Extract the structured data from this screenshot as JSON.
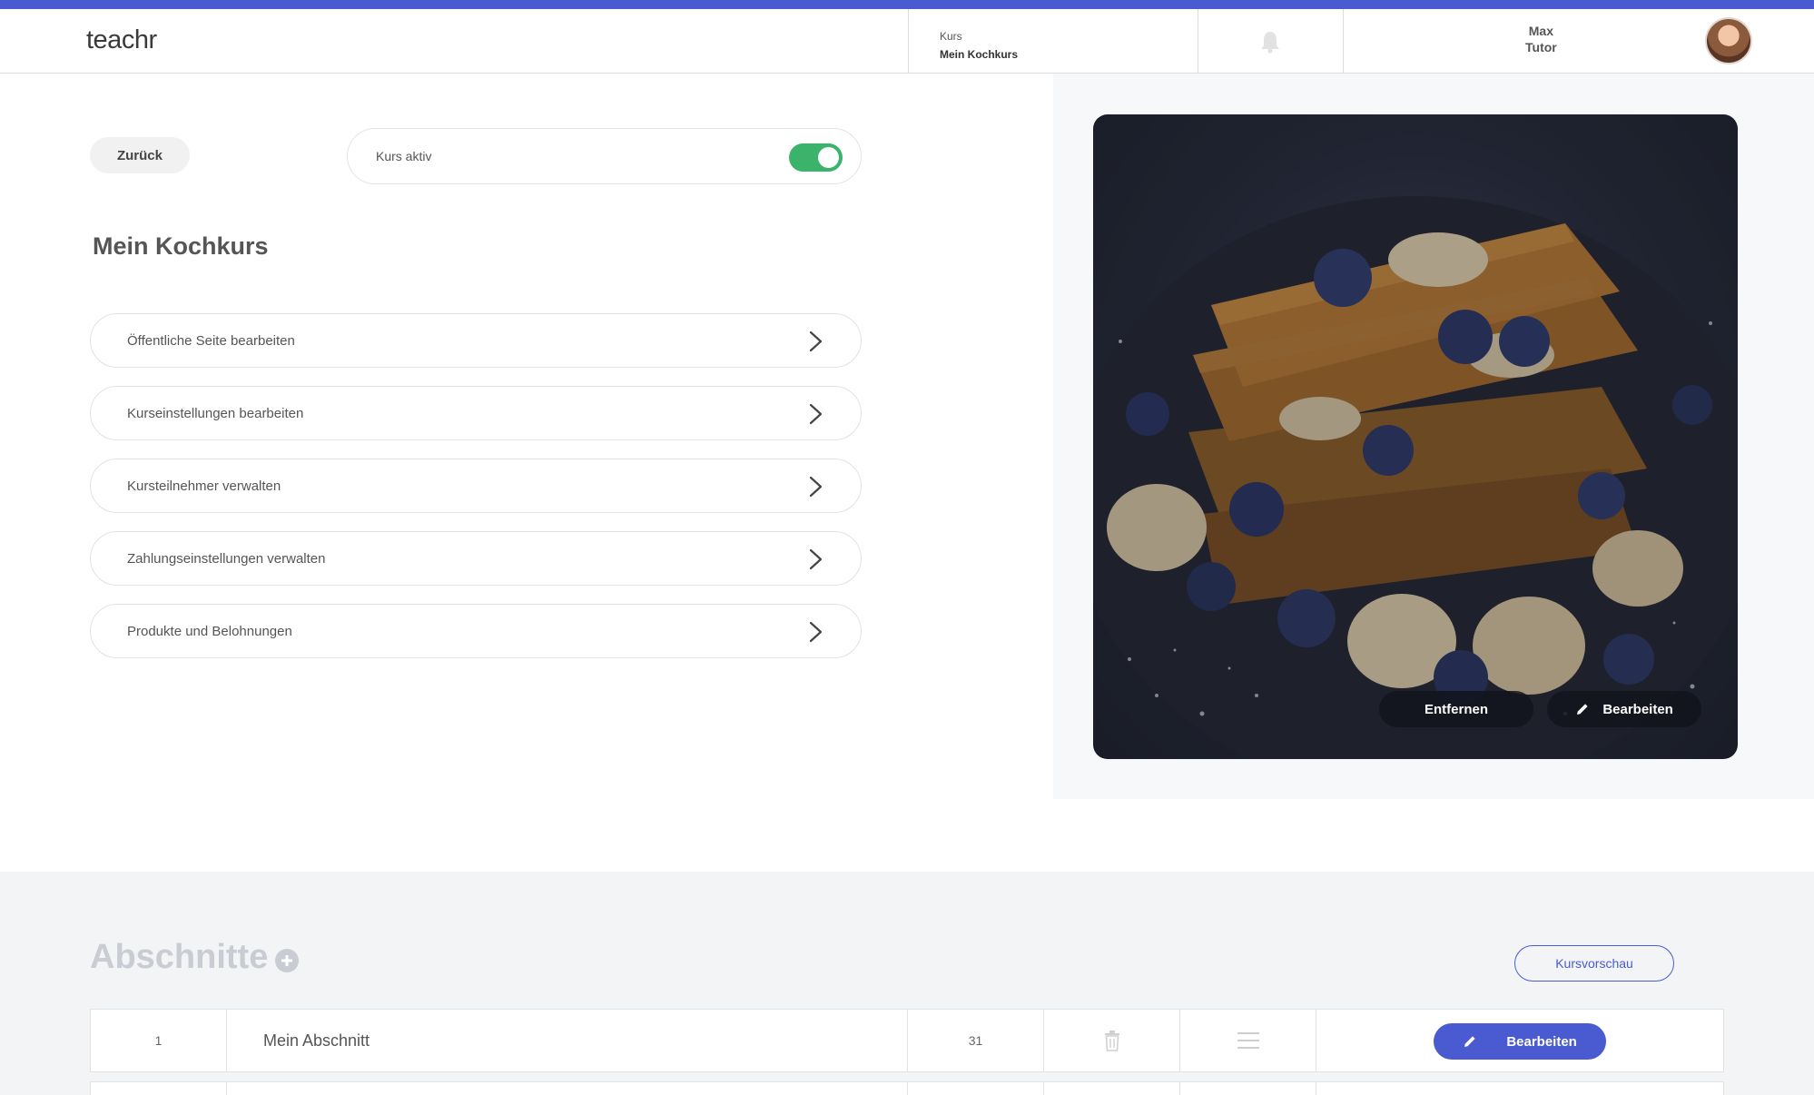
{
  "colors": {
    "accent": "#4a5bd1",
    "toggle_on": "#3bb36b"
  },
  "header": {
    "logo": "teachr",
    "course_label": "Kurs",
    "course_name": "Mein Kochkurs",
    "bell_icon": "bell-icon",
    "user_first": "Max",
    "user_role": "Tutor"
  },
  "controls": {
    "back_label": "Zurück",
    "active_label": "Kurs aktiv",
    "active_on": true
  },
  "course": {
    "title": "Mein Kochkurs"
  },
  "menu": [
    {
      "label": "Öffentliche Seite bearbeiten"
    },
    {
      "label": "Kurseinstellungen bearbeiten"
    },
    {
      "label": "Kursteilnehmer verwalten"
    },
    {
      "label": "Zahlungseinstellungen verwalten"
    },
    {
      "label": "Produkte und Belohnungen"
    }
  ],
  "image": {
    "remove_label": "Entfernen",
    "edit_label": "Bearbeiten"
  },
  "sections": {
    "title": "Abschnitte",
    "preview_label": "Kursvorschau",
    "rows": [
      {
        "num": "1",
        "name": "Mein Abschnitt",
        "count": "31",
        "edit_label": "Bearbeiten"
      }
    ]
  }
}
